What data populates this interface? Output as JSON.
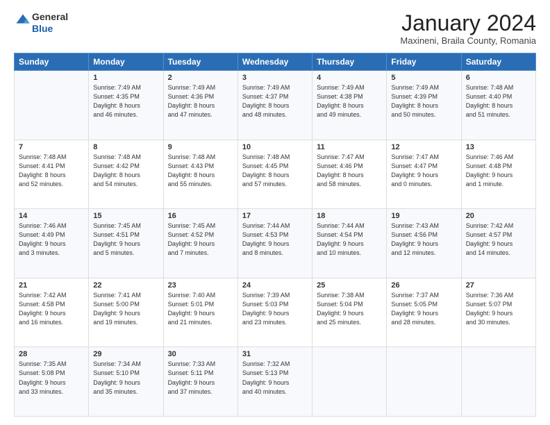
{
  "logo": {
    "general": "General",
    "blue": "Blue"
  },
  "header": {
    "title": "January 2024",
    "subtitle": "Maxineni, Braila County, Romania"
  },
  "weekdays": [
    "Sunday",
    "Monday",
    "Tuesday",
    "Wednesday",
    "Thursday",
    "Friday",
    "Saturday"
  ],
  "weeks": [
    [
      {
        "day": "",
        "info": ""
      },
      {
        "day": "1",
        "info": "Sunrise: 7:49 AM\nSunset: 4:35 PM\nDaylight: 8 hours\nand 46 minutes."
      },
      {
        "day": "2",
        "info": "Sunrise: 7:49 AM\nSunset: 4:36 PM\nDaylight: 8 hours\nand 47 minutes."
      },
      {
        "day": "3",
        "info": "Sunrise: 7:49 AM\nSunset: 4:37 PM\nDaylight: 8 hours\nand 48 minutes."
      },
      {
        "day": "4",
        "info": "Sunrise: 7:49 AM\nSunset: 4:38 PM\nDaylight: 8 hours\nand 49 minutes."
      },
      {
        "day": "5",
        "info": "Sunrise: 7:49 AM\nSunset: 4:39 PM\nDaylight: 8 hours\nand 50 minutes."
      },
      {
        "day": "6",
        "info": "Sunrise: 7:48 AM\nSunset: 4:40 PM\nDaylight: 8 hours\nand 51 minutes."
      }
    ],
    [
      {
        "day": "7",
        "info": "Sunrise: 7:48 AM\nSunset: 4:41 PM\nDaylight: 8 hours\nand 52 minutes."
      },
      {
        "day": "8",
        "info": "Sunrise: 7:48 AM\nSunset: 4:42 PM\nDaylight: 8 hours\nand 54 minutes."
      },
      {
        "day": "9",
        "info": "Sunrise: 7:48 AM\nSunset: 4:43 PM\nDaylight: 8 hours\nand 55 minutes."
      },
      {
        "day": "10",
        "info": "Sunrise: 7:48 AM\nSunset: 4:45 PM\nDaylight: 8 hours\nand 57 minutes."
      },
      {
        "day": "11",
        "info": "Sunrise: 7:47 AM\nSunset: 4:46 PM\nDaylight: 8 hours\nand 58 minutes."
      },
      {
        "day": "12",
        "info": "Sunrise: 7:47 AM\nSunset: 4:47 PM\nDaylight: 9 hours\nand 0 minutes."
      },
      {
        "day": "13",
        "info": "Sunrise: 7:46 AM\nSunset: 4:48 PM\nDaylight: 9 hours\nand 1 minute."
      }
    ],
    [
      {
        "day": "14",
        "info": "Sunrise: 7:46 AM\nSunset: 4:49 PM\nDaylight: 9 hours\nand 3 minutes."
      },
      {
        "day": "15",
        "info": "Sunrise: 7:45 AM\nSunset: 4:51 PM\nDaylight: 9 hours\nand 5 minutes."
      },
      {
        "day": "16",
        "info": "Sunrise: 7:45 AM\nSunset: 4:52 PM\nDaylight: 9 hours\nand 7 minutes."
      },
      {
        "day": "17",
        "info": "Sunrise: 7:44 AM\nSunset: 4:53 PM\nDaylight: 9 hours\nand 8 minutes."
      },
      {
        "day": "18",
        "info": "Sunrise: 7:44 AM\nSunset: 4:54 PM\nDaylight: 9 hours\nand 10 minutes."
      },
      {
        "day": "19",
        "info": "Sunrise: 7:43 AM\nSunset: 4:56 PM\nDaylight: 9 hours\nand 12 minutes."
      },
      {
        "day": "20",
        "info": "Sunrise: 7:42 AM\nSunset: 4:57 PM\nDaylight: 9 hours\nand 14 minutes."
      }
    ],
    [
      {
        "day": "21",
        "info": "Sunrise: 7:42 AM\nSunset: 4:58 PM\nDaylight: 9 hours\nand 16 minutes."
      },
      {
        "day": "22",
        "info": "Sunrise: 7:41 AM\nSunset: 5:00 PM\nDaylight: 9 hours\nand 19 minutes."
      },
      {
        "day": "23",
        "info": "Sunrise: 7:40 AM\nSunset: 5:01 PM\nDaylight: 9 hours\nand 21 minutes."
      },
      {
        "day": "24",
        "info": "Sunrise: 7:39 AM\nSunset: 5:03 PM\nDaylight: 9 hours\nand 23 minutes."
      },
      {
        "day": "25",
        "info": "Sunrise: 7:38 AM\nSunset: 5:04 PM\nDaylight: 9 hours\nand 25 minutes."
      },
      {
        "day": "26",
        "info": "Sunrise: 7:37 AM\nSunset: 5:05 PM\nDaylight: 9 hours\nand 28 minutes."
      },
      {
        "day": "27",
        "info": "Sunrise: 7:36 AM\nSunset: 5:07 PM\nDaylight: 9 hours\nand 30 minutes."
      }
    ],
    [
      {
        "day": "28",
        "info": "Sunrise: 7:35 AM\nSunset: 5:08 PM\nDaylight: 9 hours\nand 33 minutes."
      },
      {
        "day": "29",
        "info": "Sunrise: 7:34 AM\nSunset: 5:10 PM\nDaylight: 9 hours\nand 35 minutes."
      },
      {
        "day": "30",
        "info": "Sunrise: 7:33 AM\nSunset: 5:11 PM\nDaylight: 9 hours\nand 37 minutes."
      },
      {
        "day": "31",
        "info": "Sunrise: 7:32 AM\nSunset: 5:13 PM\nDaylight: 9 hours\nand 40 minutes."
      },
      {
        "day": "",
        "info": ""
      },
      {
        "day": "",
        "info": ""
      },
      {
        "day": "",
        "info": ""
      }
    ]
  ]
}
